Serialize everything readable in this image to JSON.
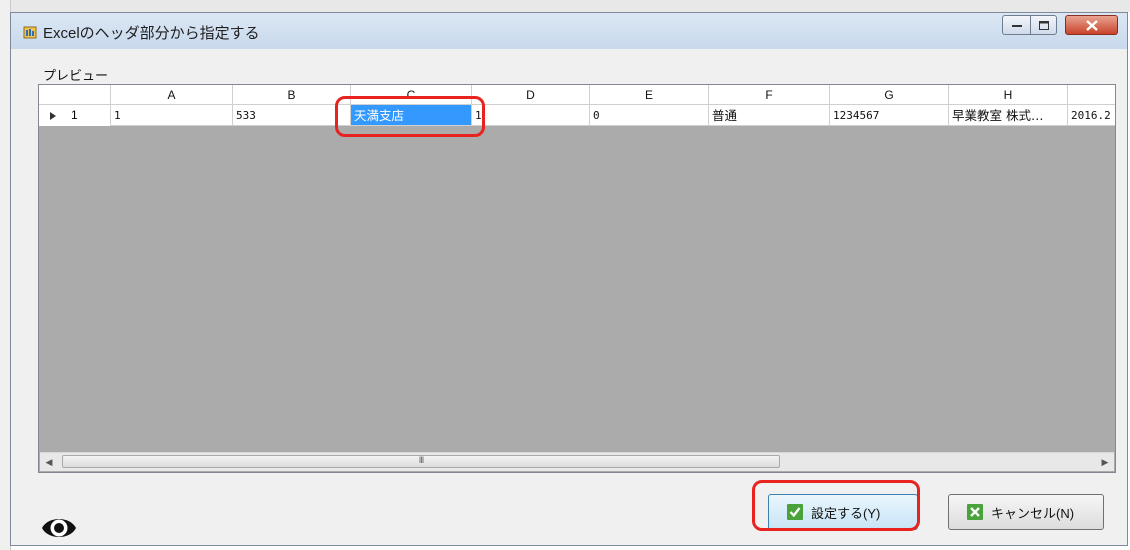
{
  "window": {
    "title": "Excelのヘッダ部分から指定する",
    "controls": {
      "minimize": "minimize",
      "maximize": "maximize",
      "close": "close"
    }
  },
  "preview": {
    "label": "プレビュー",
    "columns": [
      "A",
      "B",
      "C",
      "D",
      "E",
      "F",
      "G",
      "H"
    ],
    "rows": [
      {
        "row_number": "1",
        "cells": [
          "1",
          "533",
          "天満支店",
          "1",
          "0",
          "普通",
          "1234567",
          "早業教室 株式…",
          "2016.2"
        ]
      }
    ],
    "selected_cell": "C1",
    "scrollbar_grip": "III"
  },
  "buttons": {
    "ok_label": "設定する(Y)",
    "cancel_label": "キャンセル(N)"
  },
  "colors": {
    "selection": "#3399ff",
    "highlight": "#e8231f",
    "grid_empty": "#ababab"
  }
}
